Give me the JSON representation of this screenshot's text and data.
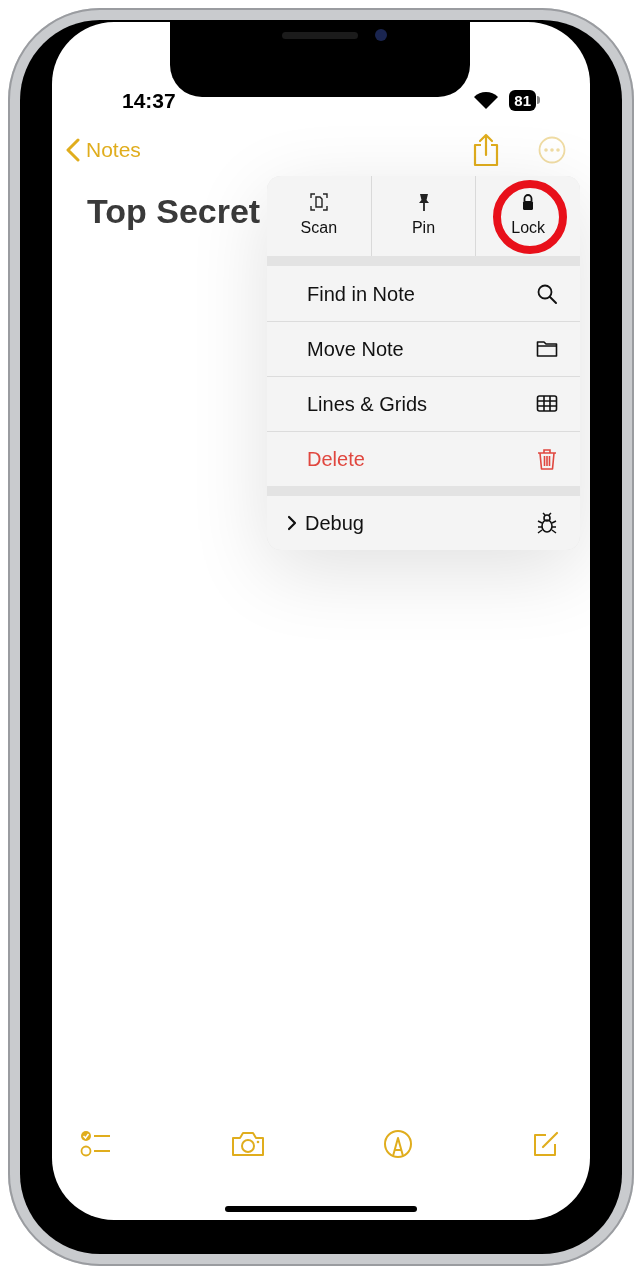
{
  "status_bar": {
    "time": "14:37",
    "battery": "81"
  },
  "nav": {
    "back_label": "Notes"
  },
  "note": {
    "title": "Top Secret"
  },
  "menu": {
    "actions": [
      {
        "label": "Scan",
        "kind": "scan",
        "highlighted": false
      },
      {
        "label": "Pin",
        "kind": "pin",
        "highlighted": false
      },
      {
        "label": "Lock",
        "kind": "lock",
        "highlighted": true
      }
    ],
    "items": [
      {
        "label": "Find in Note",
        "kind": "search",
        "destructive": false
      },
      {
        "label": "Move Note",
        "kind": "folder",
        "destructive": false
      },
      {
        "label": "Lines & Grids",
        "kind": "grid",
        "destructive": false
      },
      {
        "label": "Delete",
        "kind": "trash",
        "destructive": true
      }
    ],
    "submenu": {
      "label": "Debug",
      "kind": "bug"
    }
  }
}
